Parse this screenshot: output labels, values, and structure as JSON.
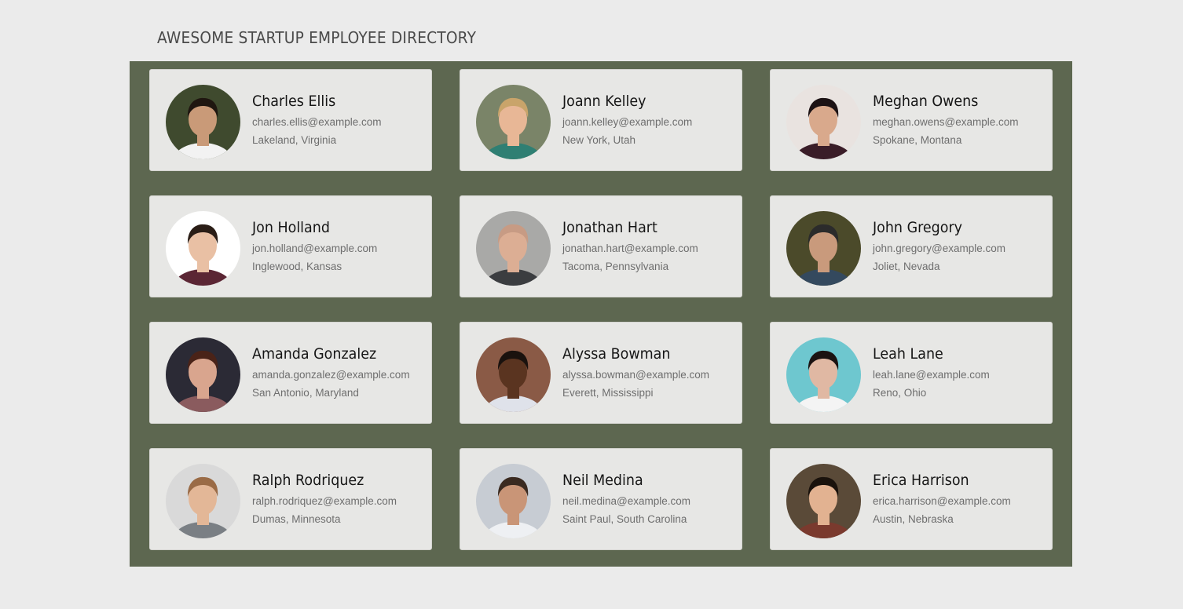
{
  "header": {
    "title": "AWESOME STARTUP EMPLOYEE DIRECTORY"
  },
  "colors": {
    "page_background": "#ebebeb",
    "directory_background": "#5d6750",
    "card_background": "#e7e7e5",
    "name_text": "#151515",
    "secondary_text": "#6e6e6e"
  },
  "employees": [
    {
      "name": "Charles Ellis",
      "email": "charles.ellis@example.com",
      "location": "Lakeland, Virginia",
      "photo": {
        "bg": "#3f4a2e",
        "skin": "#c99a78",
        "hair": "#1f1610",
        "shirt": "#f2f2f2"
      }
    },
    {
      "name": "Joann Kelley",
      "email": "joann.kelley@example.com",
      "location": "New York, Utah",
      "photo": {
        "bg": "#7a8468",
        "skin": "#e8b796",
        "hair": "#c9a46a",
        "shirt": "#2f7f73"
      }
    },
    {
      "name": "Meghan Owens",
      "email": "meghan.owens@example.com",
      "location": "Spokane, Montana",
      "photo": {
        "bg": "#e9e3e0",
        "skin": "#d9a98c",
        "hair": "#1c1214",
        "shirt": "#3a1d28"
      }
    },
    {
      "name": "Jon Holland",
      "email": "jon.holland@example.com",
      "location": "Inglewood, Kansas",
      "photo": {
        "bg": "#ffffff",
        "skin": "#e9c0a4",
        "hair": "#2a1d16",
        "shirt": "#5b2634"
      }
    },
    {
      "name": "Jonathan Hart",
      "email": "jonathan.hart@example.com",
      "location": "Tacoma, Pennsylvania",
      "photo": {
        "bg": "#a9a9a7",
        "skin": "#dcae94",
        "hair": "#c79b84",
        "shirt": "#3b3d40"
      }
    },
    {
      "name": "John Gregory",
      "email": "john.gregory@example.com",
      "location": "Joliet, Nevada",
      "photo": {
        "bg": "#4b4a2a",
        "skin": "#c99a7c",
        "hair": "#2b2b2b",
        "shirt": "#34495e"
      }
    },
    {
      "name": "Amanda Gonzalez",
      "email": "amanda.gonzalez@example.com",
      "location": "San Antonio, Maryland",
      "photo": {
        "bg": "#2b2a35",
        "skin": "#d9a58e",
        "hair": "#4a2318",
        "shirt": "#8a5b5e"
      }
    },
    {
      "name": "Alyssa Bowman",
      "email": "alyssa.bowman@example.com",
      "location": "Everett, Mississippi",
      "photo": {
        "bg": "#8a5a46",
        "skin": "#5a3420",
        "hair": "#1a120e",
        "shirt": "#dfe2ea"
      }
    },
    {
      "name": "Leah Lane",
      "email": "leah.lane@example.com",
      "location": "Reno, Ohio",
      "photo": {
        "bg": "#6ec7cf",
        "skin": "#e0b8a3",
        "hair": "#1b1312",
        "shirt": "#f4f4f4"
      }
    },
    {
      "name": "Ralph Rodriquez",
      "email": "ralph.rodriquez@example.com",
      "location": "Dumas, Minnesota",
      "photo": {
        "bg": "#d9d9d9",
        "skin": "#e3b797",
        "hair": "#9a6b46",
        "shirt": "#7a7f84"
      }
    },
    {
      "name": "Neil Medina",
      "email": "neil.medina@example.com",
      "location": "Saint Paul, South Carolina",
      "photo": {
        "bg": "#c7ccd3",
        "skin": "#c99577",
        "hair": "#3a2a20",
        "shirt": "#eef0f3"
      }
    },
    {
      "name": "Erica Harrison",
      "email": "erica.harrison@example.com",
      "location": "Austin, Nebraska",
      "photo": {
        "bg": "#5a4a38",
        "skin": "#e2b291",
        "hair": "#1a120c",
        "shirt": "#7a3a2e"
      }
    }
  ]
}
